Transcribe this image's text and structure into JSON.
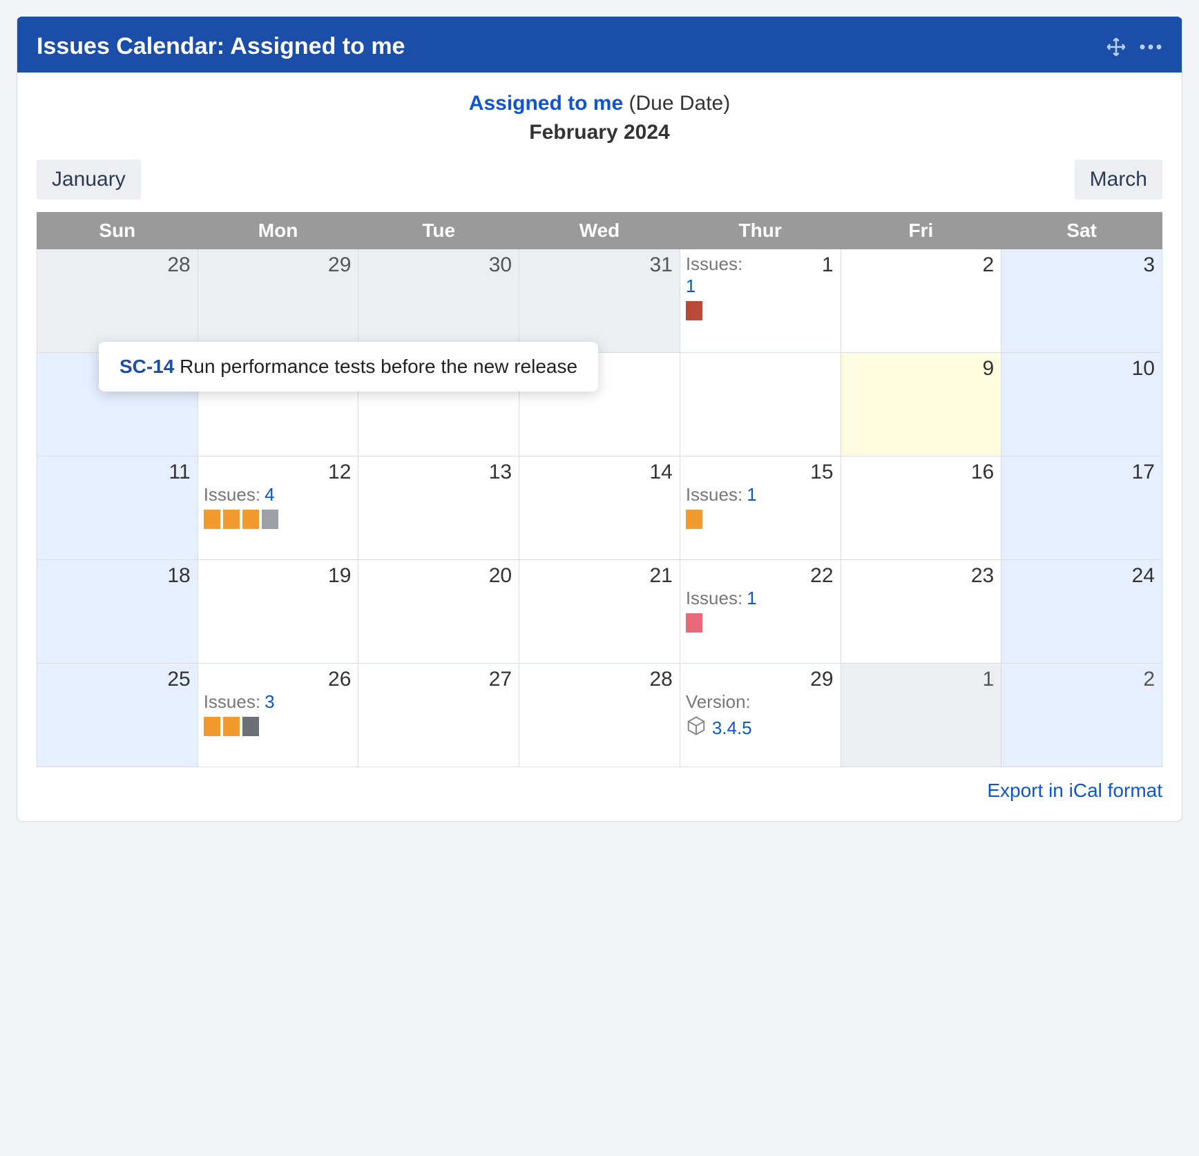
{
  "panel": {
    "title": "Issues Calendar: Assigned to me"
  },
  "header": {
    "link_text": "Assigned to me",
    "suffix": "(Due Date)",
    "month": "February 2024"
  },
  "nav": {
    "prev": "January",
    "next": "March"
  },
  "days": [
    "Sun",
    "Mon",
    "Tue",
    "Wed",
    "Thur",
    "Fri",
    "Sat"
  ],
  "cells": {
    "r0c0": {
      "num": "28"
    },
    "r0c1": {
      "num": "29"
    },
    "r0c2": {
      "num": "30"
    },
    "r0c3": {
      "num": "31"
    },
    "r0c4": {
      "num": "1",
      "issues_label": "Issues:",
      "issues_count": "1"
    },
    "r0c5": {
      "num": "2"
    },
    "r0c6": {
      "num": "3"
    },
    "r1c5": {
      "num": "9"
    },
    "r1c6": {
      "num": "10"
    },
    "r2c0": {
      "num": "11"
    },
    "r2c1": {
      "num": "12",
      "issues_label": "Issues:",
      "issues_count": "4"
    },
    "r2c2": {
      "num": "13"
    },
    "r2c3": {
      "num": "14"
    },
    "r2c4": {
      "num": "15",
      "issues_label": "Issues:",
      "issues_count": "1"
    },
    "r2c5": {
      "num": "16"
    },
    "r2c6": {
      "num": "17"
    },
    "r3c0": {
      "num": "18"
    },
    "r3c1": {
      "num": "19"
    },
    "r3c2": {
      "num": "20"
    },
    "r3c3": {
      "num": "21"
    },
    "r3c4": {
      "num": "22",
      "issues_label": "Issues:",
      "issues_count": "1"
    },
    "r3c5": {
      "num": "23"
    },
    "r3c6": {
      "num": "24"
    },
    "r4c0": {
      "num": "25"
    },
    "r4c1": {
      "num": "26",
      "issues_label": "Issues:",
      "issues_count": "3"
    },
    "r4c2": {
      "num": "27"
    },
    "r4c3": {
      "num": "28"
    },
    "r4c4": {
      "num": "29",
      "version_label": "Version:",
      "version_num": "3.4.5"
    },
    "r4c5": {
      "num": "1"
    },
    "r4c6": {
      "num": "2"
    }
  },
  "tooltip": {
    "key": "SC-14",
    "summary": "Run performance tests before the new release"
  },
  "export": {
    "label": "Export in iCal format"
  }
}
